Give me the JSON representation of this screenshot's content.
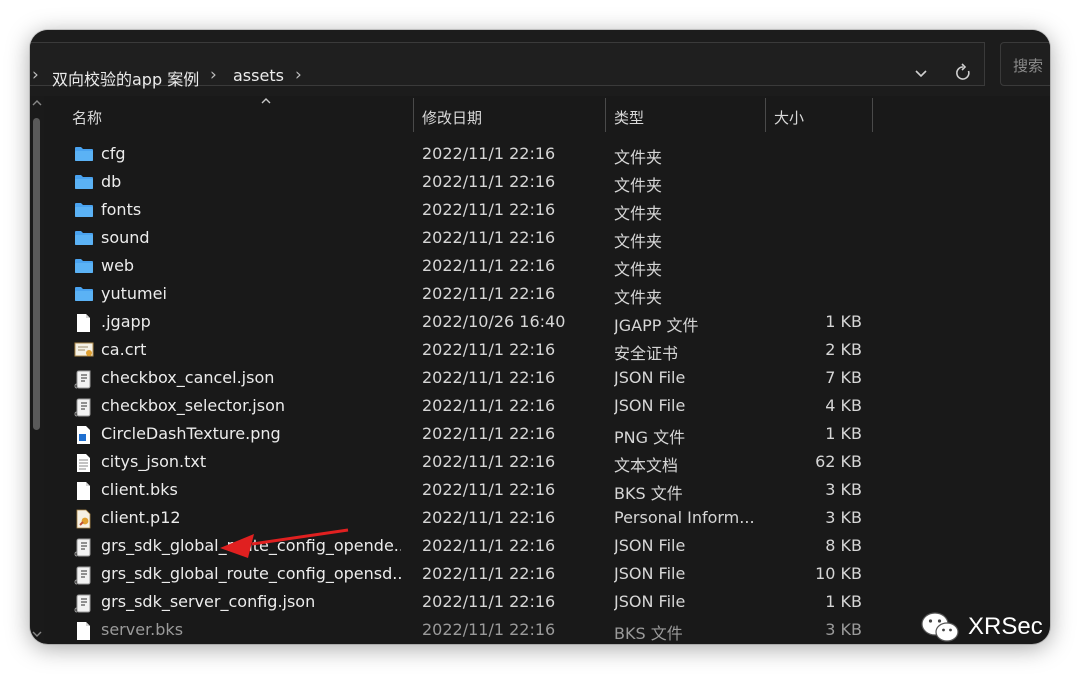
{
  "address": {
    "breadcrumbs": [
      "双向校验的app 案例",
      "assets"
    ],
    "separator": "›",
    "dropdown_icon": "chevron-down-icon",
    "refresh_icon": "refresh-icon",
    "search_placeholder": "搜索"
  },
  "columns": {
    "name": "名称",
    "date": "修改日期",
    "type": "类型",
    "size": "大小"
  },
  "files": [
    {
      "name": "cfg",
      "date": "2022/11/1 22:16",
      "type": "文件夹",
      "size": "",
      "icon": "folder-icon"
    },
    {
      "name": "db",
      "date": "2022/11/1 22:16",
      "type": "文件夹",
      "size": "",
      "icon": "folder-icon"
    },
    {
      "name": "fonts",
      "date": "2022/11/1 22:16",
      "type": "文件夹",
      "size": "",
      "icon": "folder-icon"
    },
    {
      "name": "sound",
      "date": "2022/11/1 22:16",
      "type": "文件夹",
      "size": "",
      "icon": "folder-icon"
    },
    {
      "name": "web",
      "date": "2022/11/1 22:16",
      "type": "文件夹",
      "size": "",
      "icon": "folder-icon"
    },
    {
      "name": "yutumei",
      "date": "2022/11/1 22:16",
      "type": "文件夹",
      "size": "",
      "icon": "folder-icon"
    },
    {
      "name": ".jgapp",
      "date": "2022/10/26 16:40",
      "type": "JGAPP 文件",
      "size": "1 KB",
      "icon": "file-icon"
    },
    {
      "name": "ca.crt",
      "date": "2022/11/1 22:16",
      "type": "安全证书",
      "size": "2 KB",
      "icon": "certificate-icon"
    },
    {
      "name": "checkbox_cancel.json",
      "date": "2022/11/1 22:16",
      "type": "JSON File",
      "size": "7 KB",
      "icon": "json-file-icon"
    },
    {
      "name": "checkbox_selector.json",
      "date": "2022/11/1 22:16",
      "type": "JSON File",
      "size": "4 KB",
      "icon": "json-file-icon"
    },
    {
      "name": "CircleDashTexture.png",
      "date": "2022/11/1 22:16",
      "type": "PNG 文件",
      "size": "1 KB",
      "icon": "image-file-icon"
    },
    {
      "name": "citys_json.txt",
      "date": "2022/11/1 22:16",
      "type": "文本文档",
      "size": "62 KB",
      "icon": "text-file-icon"
    },
    {
      "name": "client.bks",
      "date": "2022/11/1 22:16",
      "type": "BKS 文件",
      "size": "3 KB",
      "icon": "file-icon"
    },
    {
      "name": "client.p12",
      "date": "2022/11/1 22:16",
      "type": "Personal Inform...",
      "size": "3 KB",
      "icon": "personal-cert-icon"
    },
    {
      "name": "grs_sdk_global_route_config_opende...",
      "date": "2022/11/1 22:16",
      "type": "JSON File",
      "size": "8 KB",
      "icon": "json-file-icon"
    },
    {
      "name": "grs_sdk_global_route_config_opensd...",
      "date": "2022/11/1 22:16",
      "type": "JSON File",
      "size": "10 KB",
      "icon": "json-file-icon"
    },
    {
      "name": "grs_sdk_server_config.json",
      "date": "2022/11/1 22:16",
      "type": "JSON File",
      "size": "1 KB",
      "icon": "json-file-icon"
    },
    {
      "name": "server.bks",
      "date": "2022/11/1 22:16",
      "type": "BKS 文件",
      "size": "3 KB",
      "icon": "file-icon"
    }
  ],
  "watermark": {
    "text": "XRSec",
    "icon": "wechat-icon"
  },
  "colors": {
    "folder": "#4aa3f0",
    "arrow": "#e02020",
    "background": "#191919"
  }
}
